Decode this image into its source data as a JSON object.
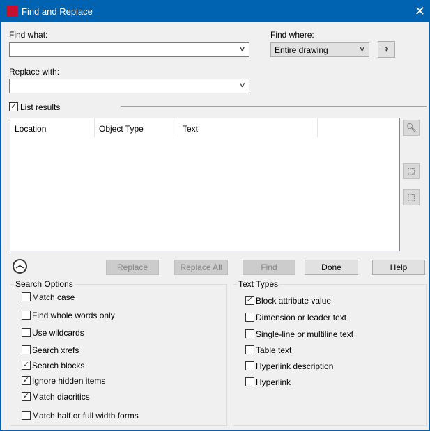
{
  "window": {
    "title": "Find and Replace",
    "logo": "A"
  },
  "find_what": {
    "label": "Find what:",
    "value": ""
  },
  "find_where": {
    "label": "Find where:",
    "selected": "Entire drawing"
  },
  "replace_with": {
    "label": "Replace with:",
    "value": ""
  },
  "list_results": {
    "label": "List results",
    "checked": true
  },
  "results": {
    "columns": [
      "Location",
      "Object Type",
      "Text",
      ""
    ]
  },
  "buttons": {
    "replace": "Replace",
    "replace_all": "Replace All",
    "find": "Find",
    "done": "Done",
    "help": "Help"
  },
  "search_options": {
    "title": "Search Options",
    "items": [
      {
        "label": "Match case",
        "checked": false
      },
      {
        "label": "Find whole words only",
        "checked": false
      },
      {
        "label": "Use wildcards",
        "checked": false
      },
      {
        "label": "Search xrefs",
        "checked": false
      },
      {
        "label": "Search blocks",
        "checked": true
      },
      {
        "label": "Ignore hidden items",
        "checked": true
      },
      {
        "label": "Match diacritics",
        "checked": true
      },
      {
        "label": "Match half or full width forms",
        "checked": false
      }
    ]
  },
  "text_types": {
    "title": "Text Types",
    "items": [
      {
        "label": "Block attribute value",
        "checked": true
      },
      {
        "label": "Dimension or leader text",
        "checked": false
      },
      {
        "label": "Single-line or multiline text",
        "checked": false
      },
      {
        "label": "Table text",
        "checked": false
      },
      {
        "label": "Hyperlink description",
        "checked": false
      },
      {
        "label": "Hyperlink",
        "checked": false
      }
    ]
  },
  "colors": {
    "titlebar": "#0063b1",
    "logo": "#c8102e"
  }
}
